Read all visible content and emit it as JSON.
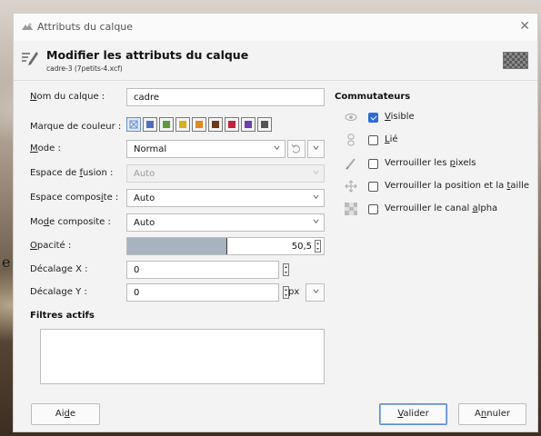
{
  "background": {
    "partial_letter": "e"
  },
  "titlebar": {
    "title": "Attributs du calque",
    "close_glyph": "✕"
  },
  "header": {
    "title": "Modifier les attributs du calque",
    "subtitle": "cadre-3 (7petits-4.xcf)",
    "icon": "edit-layer-icon"
  },
  "form": {
    "name_label_u": "N",
    "name_label_rest": "om du calque :",
    "name_value": "cadre",
    "color_label": "Marque de couleur :",
    "color_tags": [
      "none",
      "#4e6ec2",
      "#5e9a3b",
      "#d6b31c",
      "#e08a1b",
      "#6b3a16",
      "#c5223a",
      "#6b3fb0",
      "#555555"
    ],
    "mode_label_u": "M",
    "mode_label_rest": "ode :",
    "mode_value": "Normal",
    "blend_space_label_a": "Espace de ",
    "blend_space_label_u": "f",
    "blend_space_label_b": "usion :",
    "blend_space_value": "Auto",
    "composite_space_label_a": "Espace compos",
    "composite_space_label_u": "i",
    "composite_space_label_b": "te :",
    "composite_space_value": "Auto",
    "composite_mode_label_a": "Mo",
    "composite_mode_label_u": "d",
    "composite_mode_label_b": "e composite :",
    "composite_mode_value": "Auto",
    "opacity_label_u": "O",
    "opacity_label_rest": "pacité :",
    "opacity_value": "50,5",
    "opacity_fraction": 0.505,
    "offset_x_label": "Décalage X :",
    "offset_x_value": "0",
    "offset_y_label": "Décalage Y :",
    "offset_y_value": "0",
    "unit_value": "px",
    "filters_title": "Filtres actifs"
  },
  "switches": {
    "title": "Commutateurs",
    "items": [
      {
        "label_u": "V",
        "label_rest": "isible",
        "checked": true,
        "icon": "eye-icon"
      },
      {
        "label_u": "L",
        "label_rest": "ié",
        "checked": false,
        "icon": "chain-icon"
      },
      {
        "label_a": "Verrouiller les ",
        "label_u": "p",
        "label_b": "ixels",
        "checked": false,
        "icon": "brush-icon"
      },
      {
        "label_a": "Verrouiller la position et la ",
        "label_u": "t",
        "label_b": "aille",
        "checked": false,
        "icon": "move-icon"
      },
      {
        "label_a": "Verrouiller le canal ",
        "label_u": "a",
        "label_b": "lpha",
        "checked": false,
        "icon": "checkerboard-icon"
      }
    ]
  },
  "buttons": {
    "help_a": "Ai",
    "help_u": "d",
    "help_b": "e",
    "ok_u": "V",
    "ok_rest": "alider",
    "cancel_a": "A",
    "cancel_u": "n",
    "cancel_b": "nuler"
  }
}
